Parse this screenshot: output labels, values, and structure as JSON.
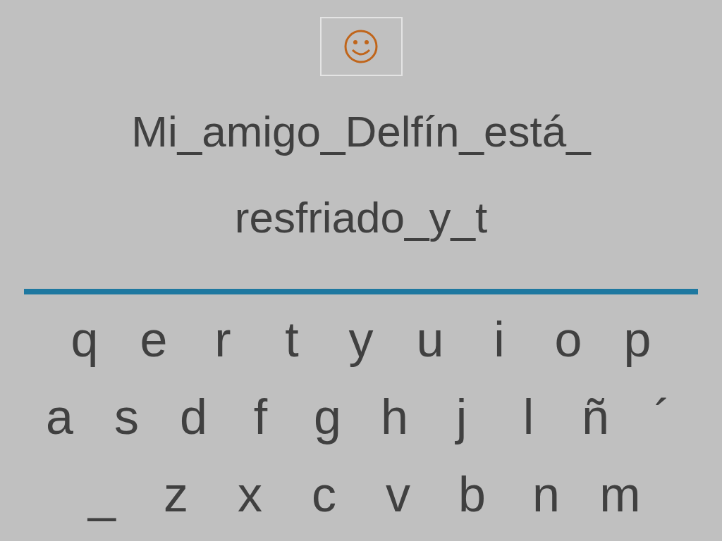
{
  "sentence_lines": [
    "Mi_amigo_Delfín_está_",
    "resfriado_y_t"
  ],
  "keyboard_rows": [
    [
      "q",
      "e",
      "r",
      "t",
      "y",
      "u",
      "i",
      "o",
      "p"
    ],
    [
      "a",
      "s",
      "d",
      "f",
      "g",
      "h",
      "j",
      "l",
      "ñ",
      "´"
    ],
    [
      "_",
      "z",
      "x",
      "c",
      "v",
      "b",
      "n",
      "m"
    ]
  ]
}
